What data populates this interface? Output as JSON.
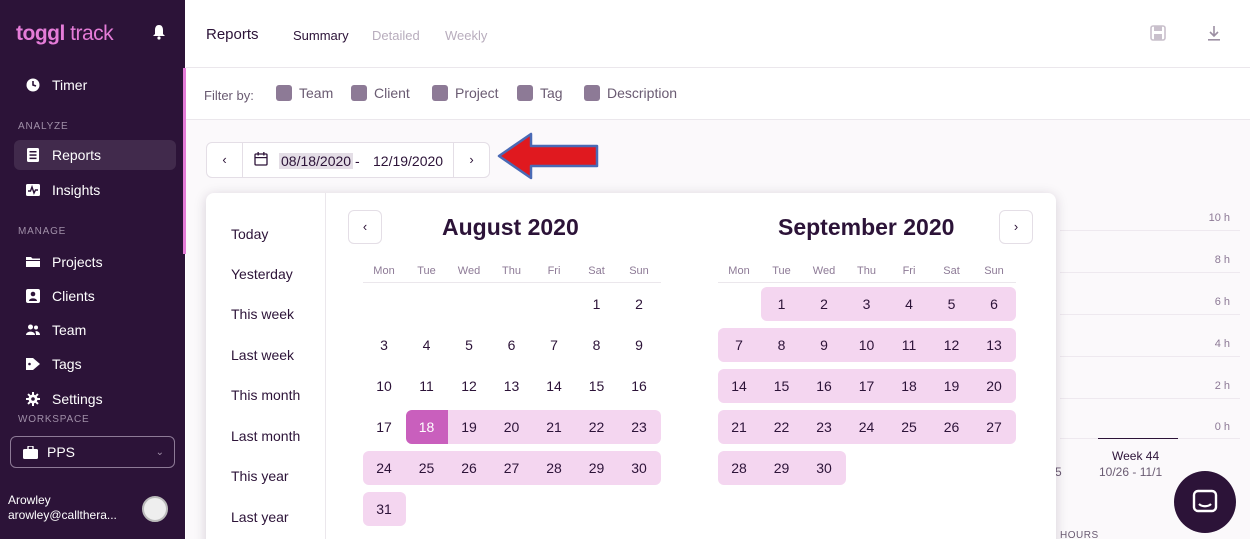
{
  "app": {
    "logo_brand": "toggl",
    "logo_product": "track"
  },
  "sidebar": {
    "timer": "Timer",
    "analyze_label": "ANALYZE",
    "reports": "Reports",
    "insights": "Insights",
    "manage_label": "MANAGE",
    "projects": "Projects",
    "clients": "Clients",
    "team": "Team",
    "tags": "Tags",
    "settings": "Settings",
    "workspace_label": "WORKSPACE",
    "workspace": "PPS",
    "user_name": "Arowley",
    "user_email": "arowley@callthera..."
  },
  "header": {
    "title": "Reports",
    "tabs": [
      "Summary",
      "Detailed",
      "Weekly"
    ]
  },
  "filters": {
    "label": "Filter by:",
    "items": [
      "Team",
      "Client",
      "Project",
      "Tag",
      "Description"
    ]
  },
  "date_range": {
    "start": "08/18/2020",
    "separator": "-",
    "end": "12/19/2020"
  },
  "presets": [
    "Today",
    "Yesterday",
    "This week",
    "Last week",
    "This month",
    "Last month",
    "This year",
    "Last year"
  ],
  "calendars": [
    {
      "title": "August 2020"
    },
    {
      "title": "September 2020"
    }
  ],
  "weekdays": [
    "Mon",
    "Tue",
    "Wed",
    "Thu",
    "Fri",
    "Sat",
    "Sun"
  ],
  "chart_bg": {
    "y_ticks": [
      "10 h",
      "8 h",
      "6 h",
      "4 h",
      "2 h",
      "0 h"
    ],
    "week_label": "Week 44",
    "week_range": "10/26 - 11/1",
    "prev_week_fragment": "5",
    "hours_label": "HOURS"
  },
  "colors": {
    "sidebar_bg": "#2c1338",
    "accent": "#e57cd8",
    "range_band": "#f4d6f0",
    "selected_day": "#c95fbd",
    "annotation_arrow": "#e0191f"
  }
}
